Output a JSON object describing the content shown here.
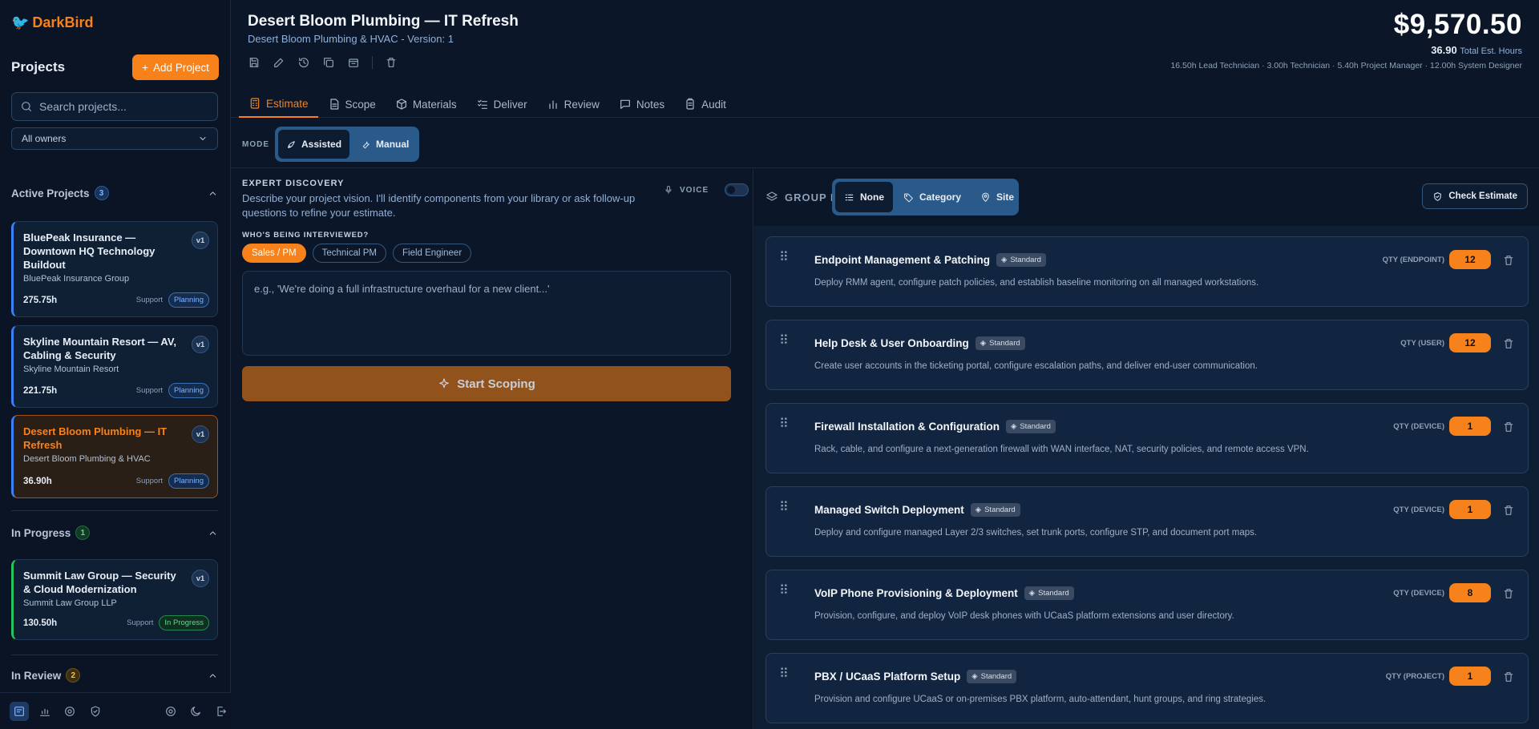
{
  "app": {
    "name": "DarkBird"
  },
  "sidebar": {
    "projects_title": "Projects",
    "add_project": "Add Project",
    "search_placeholder": "Search projects...",
    "owner_filter": "All owners",
    "sections": {
      "active": {
        "label": "Active Projects",
        "count": "3"
      },
      "in_progress": {
        "label": "In Progress",
        "count": "1"
      },
      "in_review": {
        "label": "In Review",
        "count": "2"
      }
    },
    "cards": [
      {
        "title": "BluePeak Insurance — Downtown HQ Technology Buildout",
        "client": "BluePeak Insurance Group",
        "hours": "275.75h",
        "support": "Support",
        "status": "Planning",
        "version": "v1"
      },
      {
        "title": "Skyline Mountain Resort — AV, Cabling & Security",
        "client": "Skyline Mountain Resort",
        "hours": "221.75h",
        "support": "Support",
        "status": "Planning",
        "version": "v1"
      },
      {
        "title": "Desert Bloom Plumbing — IT Refresh",
        "client": "Desert Bloom Plumbing & HVAC",
        "hours": "36.90h",
        "support": "Support",
        "status": "Planning",
        "version": "v1"
      },
      {
        "title": "Summit Law Group — Security & Cloud Modernization",
        "client": "Summit Law Group LLP",
        "hours": "130.50h",
        "support": "Support",
        "status": "In Progress",
        "version": "v1"
      }
    ]
  },
  "header": {
    "title": "Desert Bloom Plumbing — IT Refresh",
    "subtitle": "Desert Bloom Plumbing & HVAC - Version: 1",
    "price": "$9,570.50",
    "hours_value": "36.90",
    "hours_label": "Total Est. Hours",
    "roles": "16.50h Lead Technician · 3.00h Technician · 5.40h Project Manager · 12.00h System Designer"
  },
  "tabs": [
    "Estimate",
    "Scope",
    "Materials",
    "Deliver",
    "Review",
    "Notes",
    "Audit"
  ],
  "mode": {
    "label": "MODE",
    "assisted": "Assisted",
    "manual": "Manual"
  },
  "discovery": {
    "heading": "EXPERT DISCOVERY",
    "description": "Describe your project vision. I'll identify components from your library or ask follow-up questions to refine your estimate.",
    "voice": "VOICE",
    "who_label": "WHO'S BEING INTERVIEWED?",
    "chips": [
      "Sales / PM",
      "Technical PM",
      "Field Engineer"
    ],
    "placeholder": "e.g., 'We're doing a full infrastructure overhaul for a new client...'",
    "start": "Start Scoping"
  },
  "group": {
    "label": "GROUP BY",
    "none": "None",
    "category": "Category",
    "site": "Site",
    "check": "Check Estimate"
  },
  "items": [
    {
      "name": "Endpoint Management & Patching",
      "badge": "Standard",
      "desc": "Deploy RMM agent, configure patch policies, and establish baseline monitoring on all managed workstations.",
      "qty_label": "QTY (ENDPOINT)",
      "qty": "12"
    },
    {
      "name": "Help Desk & User Onboarding",
      "badge": "Standard",
      "desc": "Create user accounts in the ticketing portal, configure escalation paths, and deliver end-user communication.",
      "qty_label": "QTY (USER)",
      "qty": "12"
    },
    {
      "name": "Firewall Installation & Configuration",
      "badge": "Standard",
      "desc": "Rack, cable, and configure a next-generation firewall with WAN interface, NAT, security policies, and remote access VPN.",
      "qty_label": "QTY (DEVICE)",
      "qty": "1"
    },
    {
      "name": "Managed Switch Deployment",
      "badge": "Standard",
      "desc": "Deploy and configure managed Layer 2/3 switches, set trunk ports, configure STP, and document port maps.",
      "qty_label": "QTY (DEVICE)",
      "qty": "1"
    },
    {
      "name": "VoIP Phone Provisioning & Deployment",
      "badge": "Standard",
      "desc": "Provision, configure, and deploy VoIP desk phones with UCaaS platform extensions and user directory.",
      "qty_label": "QTY (DEVICE)",
      "qty": "8"
    },
    {
      "name": "PBX / UCaaS Platform Setup",
      "badge": "Standard",
      "desc": "Provision and configure UCaaS or on-premises PBX platform, auto-attendant, hunt groups, and ring strategies.",
      "qty_label": "QTY (PROJECT)",
      "qty": "1"
    }
  ]
}
